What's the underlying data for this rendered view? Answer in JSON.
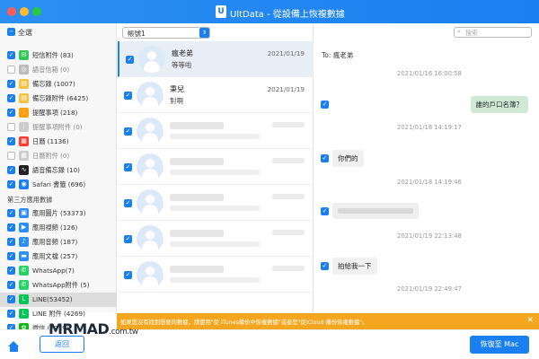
{
  "titlebar": {
    "app_logo": "U",
    "title": "UltData - 從設備上恢複數據"
  },
  "sidebar": {
    "select_all_label": "全選",
    "items_top": [
      {
        "label": "短信附件 (83)",
        "checked": "on",
        "icon": "sms-attachment-icon",
        "color": "#34c759",
        "glyph": "✉",
        "dim": false
      },
      {
        "label": "語音信箱 (0)",
        "checked": "off",
        "icon": "voicemail-icon",
        "color": "#bbbbbb",
        "glyph": "◎",
        "dim": true
      },
      {
        "label": "備忘錄 (1007)",
        "checked": "on",
        "icon": "notes-icon",
        "color": "#f5c242",
        "glyph": "▤",
        "dim": false
      },
      {
        "label": "備忘錄附件 (6425)",
        "checked": "on",
        "icon": "notes-attachment-icon",
        "color": "#f5c242",
        "glyph": "▤",
        "dim": false
      },
      {
        "label": "提醒事項 (218)",
        "checked": "on",
        "icon": "reminders-icon",
        "color": "#ff9f0a",
        "glyph": "⋮",
        "dim": false
      },
      {
        "label": "提醒事項附件 (0)",
        "checked": "off",
        "icon": "reminders-attachment-icon",
        "color": "#cccccc",
        "glyph": "⋮",
        "dim": true
      },
      {
        "label": "日曆 (1136)",
        "checked": "on",
        "icon": "calendar-icon",
        "color": "#ff3b30",
        "glyph": "▦",
        "dim": false
      },
      {
        "label": "日曆附件 (0)",
        "checked": "off",
        "icon": "calendar-attachment-icon",
        "color": "#cccccc",
        "glyph": "▦",
        "dim": true
      },
      {
        "label": "語音備忘錄 (10)",
        "checked": "on",
        "icon": "voice-memo-icon",
        "color": "#222222",
        "glyph": "∿",
        "dim": false
      },
      {
        "label": "Safari 書籤 (696)",
        "checked": "on",
        "icon": "safari-icon",
        "color": "#1a7ff0",
        "glyph": "◉",
        "dim": false
      }
    ],
    "section_label": "第三方應用數據",
    "items_third": [
      {
        "label": "應用圖片 (53373)",
        "checked": "on",
        "icon": "app-photos-icon",
        "color": "#2b8ff3",
        "glyph": "▣",
        "dim": false
      },
      {
        "label": "應用視頻 (126)",
        "checked": "on",
        "icon": "app-videos-icon",
        "color": "#2b8ff3",
        "glyph": "▶",
        "dim": false
      },
      {
        "label": "應用音頻 (187)",
        "checked": "on",
        "icon": "app-audio-icon",
        "color": "#2b8ff3",
        "glyph": "♪",
        "dim": false
      },
      {
        "label": "應用文檔 (257)",
        "checked": "on",
        "icon": "app-documents-icon",
        "color": "#2b8ff3",
        "glyph": "▬",
        "dim": false
      },
      {
        "label": "WhatsApp(7)",
        "checked": "on",
        "icon": "whatsapp-icon",
        "color": "#25d366",
        "glyph": "✆",
        "dim": false
      },
      {
        "label": "WhatsApp附件 (5)",
        "checked": "on",
        "icon": "whatsapp-attachment-icon",
        "color": "#25d366",
        "glyph": "✆",
        "dim": false
      },
      {
        "label": "LINE(53452)",
        "checked": "on",
        "icon": "line-icon",
        "color": "#06c755",
        "glyph": "L",
        "dim": false,
        "selected": true
      },
      {
        "label": "LINE 附件 (4269)",
        "checked": "on",
        "icon": "line-attachment-icon",
        "color": "#06c755",
        "glyph": "L",
        "dim": false
      },
      {
        "label": "微信 (2339)",
        "checked": "on",
        "icon": "wechat-icon",
        "color": "#09bb07",
        "glyph": "✿",
        "dim": false
      }
    ]
  },
  "filter": {
    "value": "帳號1"
  },
  "conversations": [
    {
      "name": "瘋老弟",
      "preview": "等等啦",
      "date": "2021/01/19",
      "active": true,
      "blurred": false
    },
    {
      "name": "秉兒",
      "preview": "對啊",
      "date": "2021/01/19",
      "active": false,
      "blurred": false
    },
    {
      "blurred": true
    },
    {
      "blurred": true
    },
    {
      "blurred": true
    },
    {
      "blurred": true
    },
    {
      "blurred": true
    }
  ],
  "messages": {
    "search_placeholder": "搜索",
    "to_line": "To: 瘋老弟",
    "items": [
      {
        "type": "ts",
        "text": "2021/01/16 16:00:58"
      },
      {
        "type": "out",
        "text": "誰的戶口名簿？"
      },
      {
        "type": "ts",
        "text": "2021/01/18 14:19:17"
      },
      {
        "type": "in",
        "text": "你們的"
      },
      {
        "type": "ts",
        "text": "2021/01/18 14:19:46"
      },
      {
        "type": "in-blurred",
        "text": ""
      },
      {
        "type": "ts",
        "text": "2021/01/19 22:13:48"
      },
      {
        "type": "in",
        "text": "拍給我一下"
      },
      {
        "type": "ts",
        "text": "2021/01/19 22:49:47"
      }
    ]
  },
  "banner": {
    "text": "如果您沒有找到想要的數據，請使用\"從 iTunes備份中恢複數據\"或者是\"從iCloud 備份恢複數據\"。"
  },
  "footer": {
    "back_label": "返回",
    "restore_label": "恢復至 Mac",
    "watermark": "MRMAD",
    "watermark_tld": ".com.tw"
  }
}
